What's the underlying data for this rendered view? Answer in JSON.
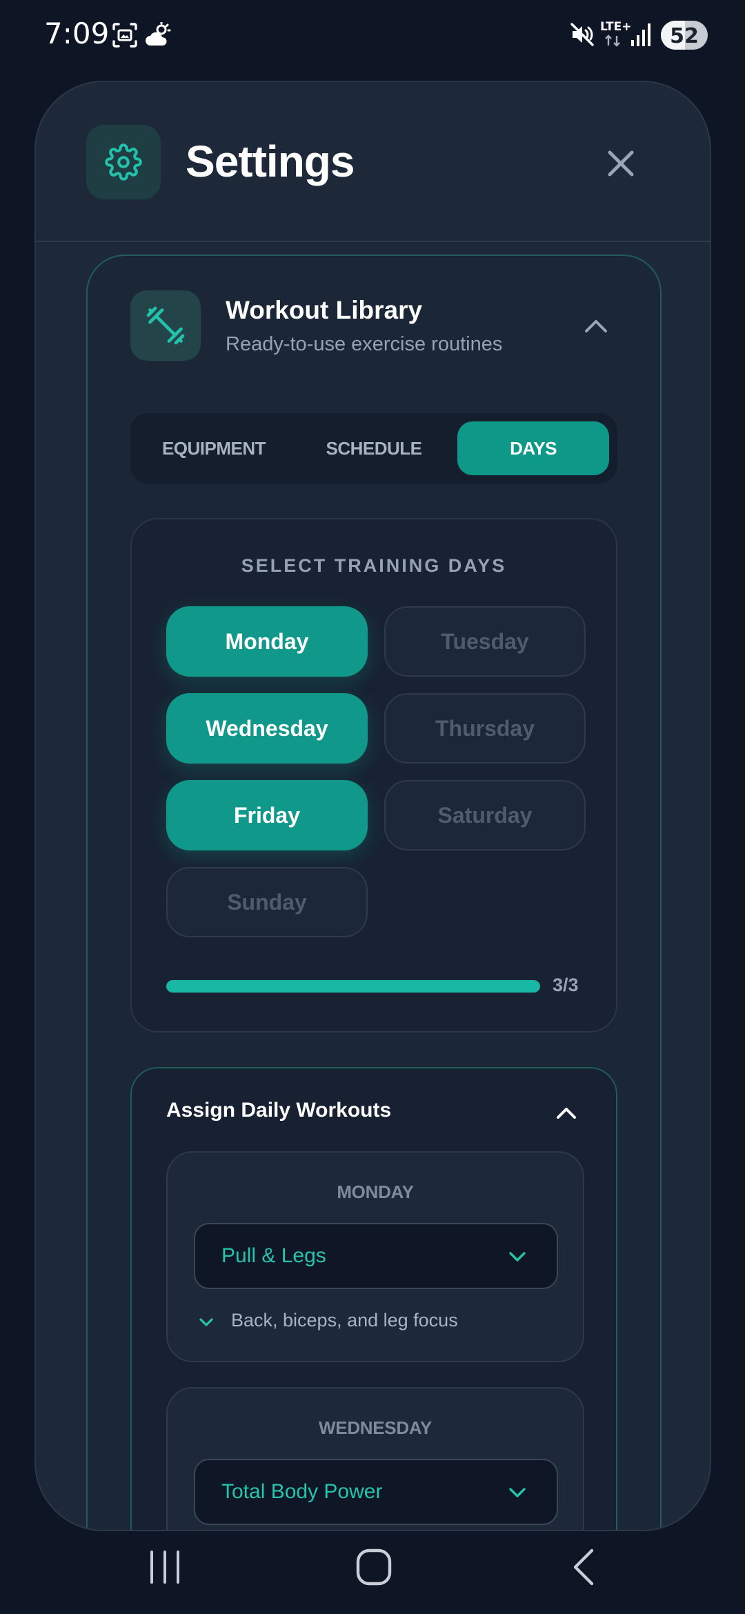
{
  "status_bar": {
    "time": "7:09",
    "network": "LTE+",
    "battery": "52",
    "icons": [
      "screenshot-icon",
      "weather-icon",
      "mute-icon",
      "signal-icon"
    ]
  },
  "modal": {
    "title": "Settings",
    "icon": "gear-icon",
    "close_icon": "close-icon"
  },
  "library": {
    "title": "Workout Library",
    "subtitle": "Ready-to-use exercise routines",
    "icon": "dumbbell-icon",
    "tabs": [
      {
        "label": "EQUIPMENT",
        "active": false
      },
      {
        "label": "SCHEDULE",
        "active": false
      },
      {
        "label": "DAYS",
        "active": true
      }
    ]
  },
  "days": {
    "heading": "SELECT TRAINING DAYS",
    "items": [
      {
        "label": "Monday",
        "selected": true
      },
      {
        "label": "Tuesday",
        "selected": false
      },
      {
        "label": "Wednesday",
        "selected": true
      },
      {
        "label": "Thursday",
        "selected": false
      },
      {
        "label": "Friday",
        "selected": true
      },
      {
        "label": "Saturday",
        "selected": false
      },
      {
        "label": "Sunday",
        "selected": false
      }
    ],
    "progress": {
      "selected": 3,
      "max": 3,
      "label": "3/3"
    }
  },
  "assign": {
    "title": "Assign Daily Workouts",
    "panels": [
      {
        "day": "MONDAY",
        "workout": "Pull & Legs",
        "description": "Back, biceps, and leg focus"
      },
      {
        "day": "WEDNESDAY",
        "workout": "Total Body Power",
        "description": ""
      }
    ]
  },
  "colors": {
    "accent": "#10998a",
    "accent_text": "#26c4ad",
    "background": "#0e1626",
    "panel": "#1d2938"
  }
}
